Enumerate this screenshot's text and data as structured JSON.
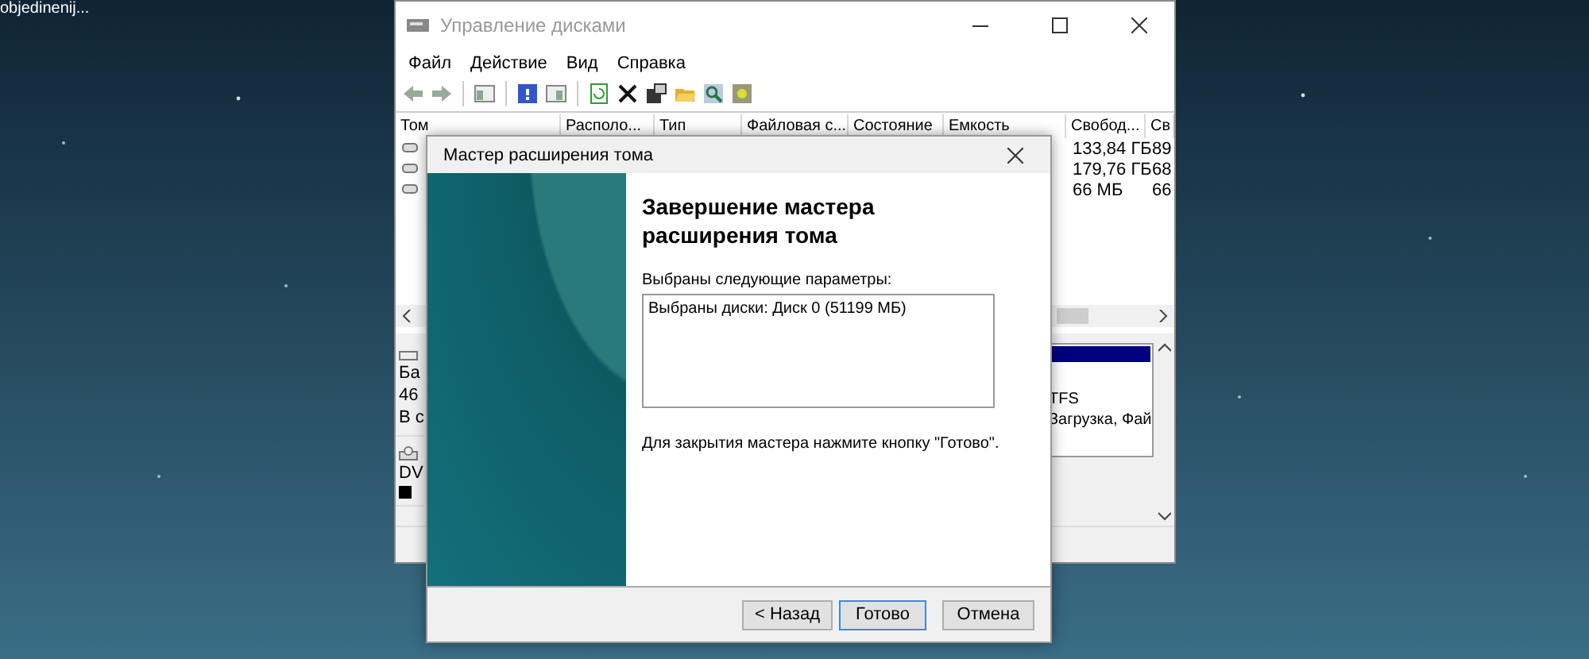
{
  "desktop": {
    "icon_label": "objedinenij..."
  },
  "window": {
    "title": "Управление дисками"
  },
  "menu": [
    "Файл",
    "Действие",
    "Вид",
    "Справка"
  ],
  "volume_list": {
    "columns": [
      "Том",
      "Располо...",
      "Тип",
      "Файловая с...",
      "Состояние",
      "Емкость",
      "Свобод...",
      "Св"
    ],
    "rows": [
      {
        "free": "133,84 ГБ",
        "column_8": "89"
      },
      {
        "free": "179,76 ГБ",
        "column_8": "68"
      },
      {
        "free": "66 МБ",
        "column_8": "66"
      }
    ]
  },
  "disk_pane": {
    "disks": [
      {
        "kind": "disk",
        "lines": [
          "Ба",
          "46",
          "В с"
        ]
      },
      {
        "kind": "dvd",
        "lines": [
          "DV"
        ]
      }
    ],
    "partition_lines": [
      "TFS",
      "Загрузка, Фай"
    ]
  },
  "dialog": {
    "title": "Мастер расширения тома",
    "heading": "Завершение мастера расширения тома",
    "params_label": "Выбраны следующие параметры:",
    "params": [
      "Выбраны диски: Диск 0 (51199 МБ)"
    ],
    "hint": "Для закрытия мастера нажмите кнопку \"Готово\".",
    "buttons": [
      {
        "label": "< Назад",
        "default": false
      },
      {
        "label": "Готово",
        "default": true
      },
      {
        "label": "Отмена",
        "default": false
      }
    ]
  }
}
